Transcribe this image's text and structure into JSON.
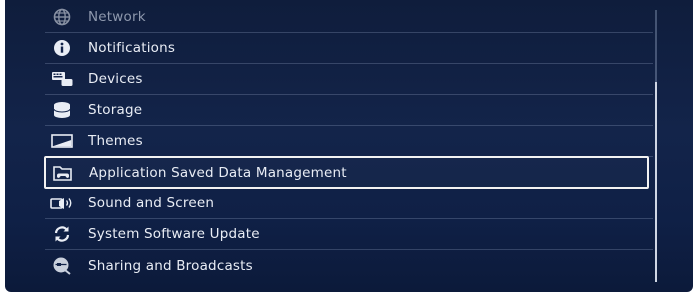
{
  "settings_list": {
    "items": [
      {
        "label": "Network",
        "icon": "globe-icon"
      },
      {
        "label": "Notifications",
        "icon": "info-icon"
      },
      {
        "label": "Devices",
        "icon": "devices-icon"
      },
      {
        "label": "Storage",
        "icon": "storage-icon"
      },
      {
        "label": "Themes",
        "icon": "themes-icon"
      },
      {
        "label": "Application Saved Data Management",
        "icon": "folder-controller-icon"
      },
      {
        "label": "Sound and Screen",
        "icon": "speaker-icon"
      },
      {
        "label": "System Software Update",
        "icon": "refresh-icon"
      },
      {
        "label": "Sharing and Broadcasts",
        "icon": "broadcast-icon"
      }
    ],
    "selected_index": 5
  },
  "colors": {
    "background": "#13244a",
    "text": "#e9edf5",
    "selection_border": "#f2f2f2"
  }
}
